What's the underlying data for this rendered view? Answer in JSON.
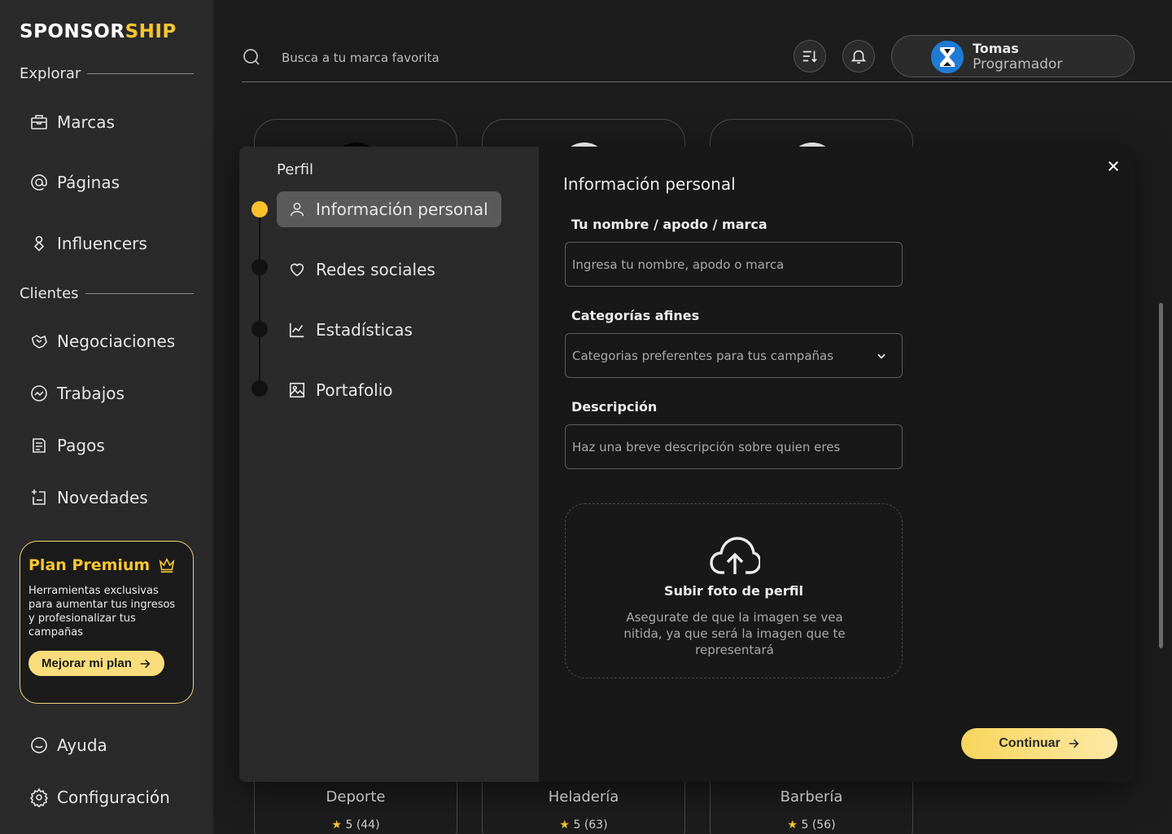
{
  "app": {
    "logo_main": "SPONSOR",
    "logo_accent": "SHIP"
  },
  "sidebar": {
    "explore_heading": "Explorar",
    "explore_items": [
      {
        "label": "Marcas",
        "icon": "briefcase-icon"
      },
      {
        "label": "Páginas",
        "icon": "at-sign-icon"
      },
      {
        "label": "Influencers",
        "icon": "influencer-icon"
      }
    ],
    "clients_heading": "Clientes",
    "client_items": [
      {
        "label": "Negociaciones",
        "icon": "handshake-icon"
      },
      {
        "label": "Trabajos",
        "icon": "trending-icon"
      },
      {
        "label": "Pagos",
        "icon": "payments-icon"
      },
      {
        "label": "Novedades",
        "icon": "news-icon"
      }
    ],
    "premium": {
      "title": "Plan Premium",
      "description": "Herramientas exclusivas para aumentar tus ingresos y profesionalizar tus campañas",
      "button_label": "Mejorar mi plan"
    },
    "bottom_items": [
      {
        "label": "Ayuda",
        "icon": "help-chat-icon"
      },
      {
        "label": "Configuración",
        "icon": "gear-icon"
      }
    ]
  },
  "header": {
    "search_placeholder": "Busca a tu marca favorita",
    "user": {
      "name": "Tomas",
      "role": "Programador"
    }
  },
  "background_cards": [
    {
      "category": "Deporte",
      "rating": "5",
      "count": "(44)"
    },
    {
      "category": "Heladería",
      "rating": "5",
      "count": "(63)"
    },
    {
      "category": "Barbería",
      "rating": "5",
      "count": "(56)"
    }
  ],
  "modal": {
    "steps_title": "Perfil",
    "steps": [
      {
        "label": "Información personal",
        "icon": "user-icon",
        "active": true
      },
      {
        "label": "Redes sociales",
        "icon": "heart-icon",
        "active": false
      },
      {
        "label": "Estadísticas",
        "icon": "chart-line-icon",
        "active": false
      },
      {
        "label": "Portafolio",
        "icon": "image-icon",
        "active": false
      }
    ],
    "form_title": "Información personal",
    "name_label": "Tu nombre / apodo / marca",
    "name_placeholder": "Ingresa tu nombre, apodo o marca",
    "categories_label": "Categorías afines",
    "categories_placeholder": "Categorias preferentes para tus campañas",
    "description_label": "Descripción",
    "description_placeholder": "Haz una breve descripción sobre quien eres",
    "upload_title": "Subir foto de perfil",
    "upload_description": "Asegurate de que la imagen se vea nitida, ya que será la imagen que te representará",
    "continue_label": "Continuar"
  },
  "colors": {
    "accent": "#f7c631",
    "background": "#1c1c1d",
    "sidebar": "#2a2a2b"
  }
}
